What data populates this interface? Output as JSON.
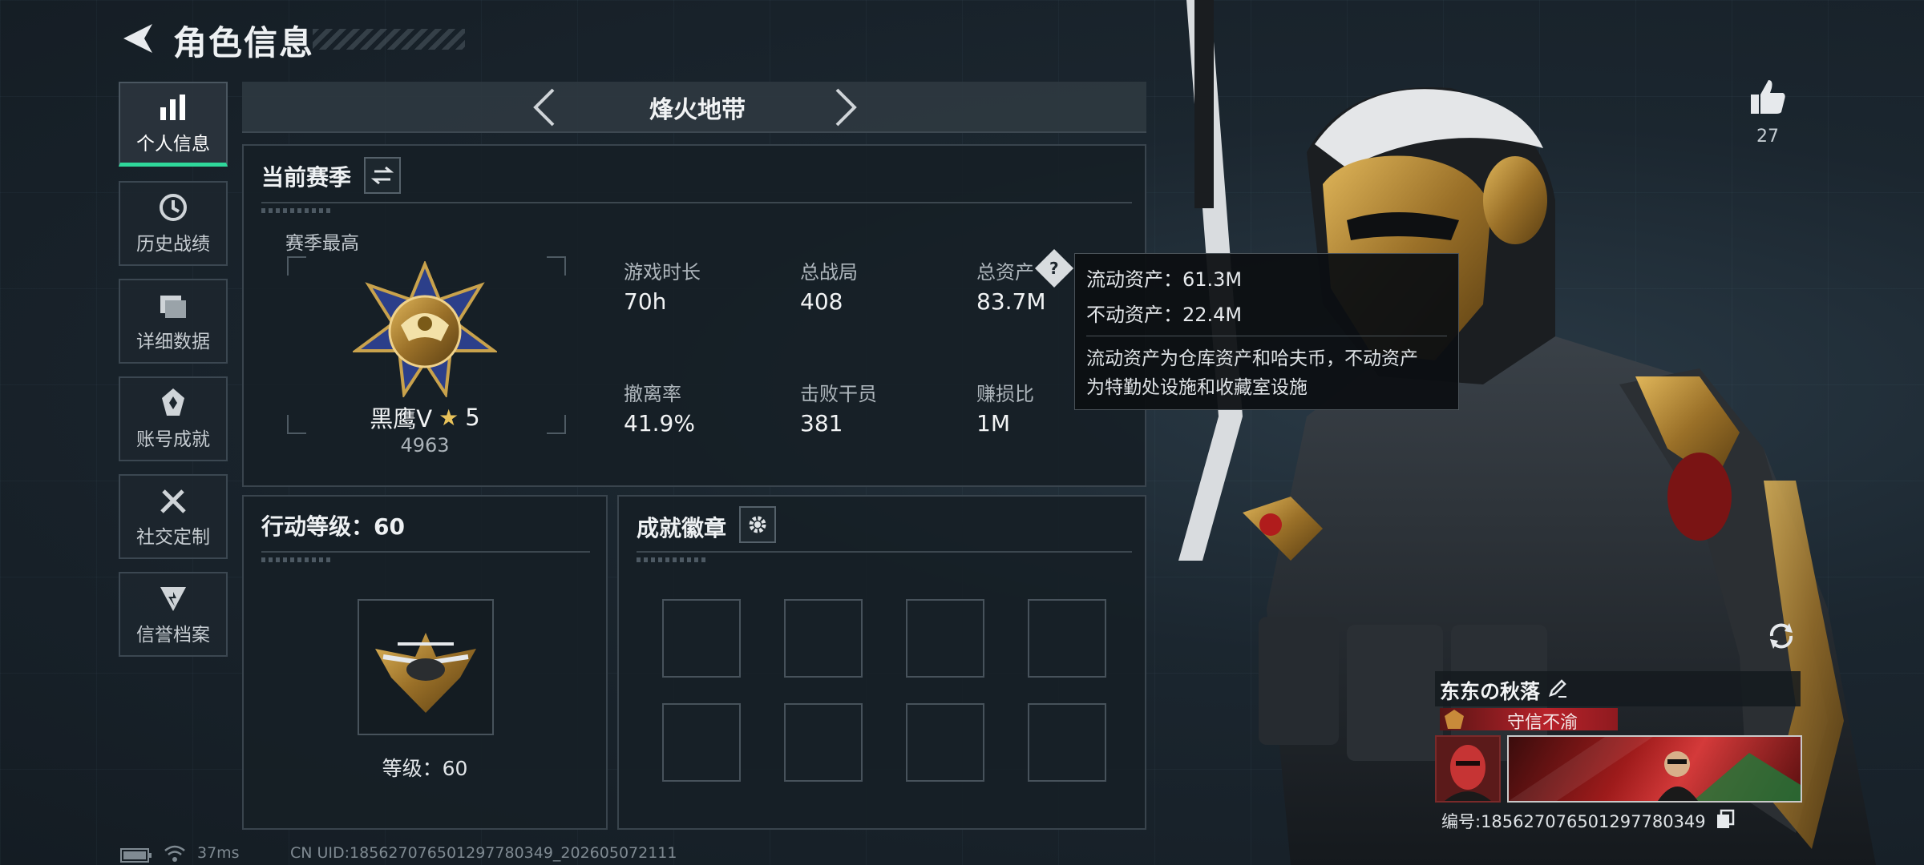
{
  "header": {
    "title": "角色信息"
  },
  "sidebar": {
    "items": [
      {
        "label": "个人信息",
        "icon": "bar-chart-icon",
        "active": true
      },
      {
        "label": "历史战绩",
        "icon": "clock-icon",
        "active": false
      },
      {
        "label": "详细数据",
        "icon": "folder-icon",
        "active": false
      },
      {
        "label": "账号成就",
        "icon": "medal-icon",
        "active": false
      },
      {
        "label": "社交定制",
        "icon": "tools-icon",
        "active": false
      },
      {
        "label": "信誉档案",
        "icon": "shield-icon",
        "active": false
      }
    ]
  },
  "mode": {
    "title": "烽火地带"
  },
  "season": {
    "title": "当前赛季",
    "best_label": "赛季最高",
    "rank_name": "黑鹰V",
    "rank_stars": "5",
    "rank_score": "4963",
    "stats": [
      {
        "label": "游戏时长",
        "value": "70h"
      },
      {
        "label": "总战局",
        "value": "408"
      },
      {
        "label": "总资产",
        "value": "83.7M"
      },
      {
        "label": "撤离率",
        "value": "41.9%"
      },
      {
        "label": "击败干员",
        "value": "381"
      },
      {
        "label": "赚损比",
        "value": "1M"
      }
    ]
  },
  "tooltip": {
    "liquid": "流动资产：61.3M",
    "fixed": "不动资产：22.4M",
    "desc_line1": "流动资产为仓库资产和哈夫币，不动资产",
    "desc_line2": "为特勤处设施和收藏室设施"
  },
  "level": {
    "title": "行动等级：60",
    "label": "等级：60"
  },
  "badges": {
    "title": "成就徽章",
    "slot_count": 8
  },
  "profile": {
    "likes": "27",
    "name": "东东の秋落",
    "title": "守信不渝",
    "id_text": "编号:1856270765012977803​49"
  },
  "status_bar": {
    "ping": "37ms",
    "uid": "CN UID:185627076501297780349_202605072111"
  },
  "colors": {
    "accent": "#2fd89b",
    "panel": "#161f26",
    "title_red": "#b8222a"
  }
}
